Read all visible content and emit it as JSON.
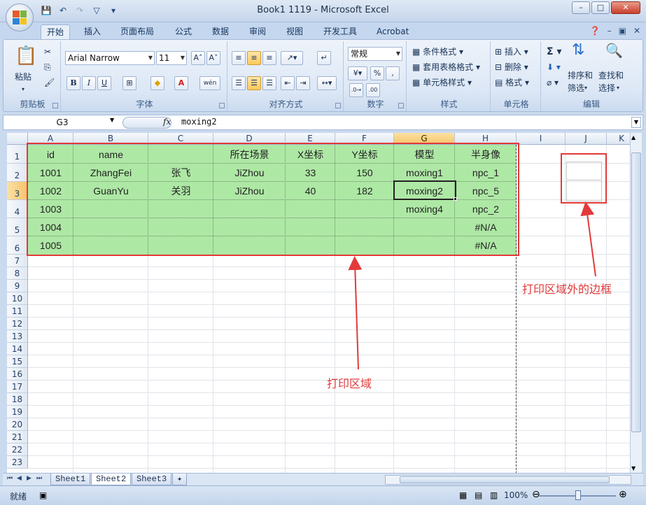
{
  "window": {
    "title": "Book1 1119 - Microsoft Excel"
  },
  "tabs": [
    "开始",
    "插入",
    "页面布局",
    "公式",
    "数据",
    "审阅",
    "视图",
    "开发工具",
    "Acrobat"
  ],
  "ribbon": {
    "groups": {
      "clipboard": "剪贴板",
      "font": "字体",
      "alignment": "对齐方式",
      "number": "数字",
      "styles": "样式",
      "cells": "单元格",
      "editing": "编辑"
    },
    "paste_label": "粘贴",
    "font_name": "Arial Narrow",
    "font_size": "11",
    "number_format": "常规",
    "styles_items": [
      "条件格式",
      "套用表格格式",
      "单元格样式"
    ],
    "cells_items": [
      "插入",
      "删除",
      "格式"
    ],
    "sort_label_1": "排序和",
    "sort_label_2": "筛选",
    "find_label_1": "查找和",
    "find_label_2": "选择",
    "percent": "%"
  },
  "formula_bar": {
    "name_box": "G3",
    "fx": "fx",
    "content": "moxing2"
  },
  "columns": [
    "A",
    "B",
    "C",
    "D",
    "E",
    "F",
    "G",
    "H",
    "I",
    "J",
    "K"
  ],
  "rows": [
    "1",
    "2",
    "3",
    "4",
    "5",
    "6",
    "7",
    "8",
    "9",
    "10",
    "11",
    "12",
    "13",
    "14",
    "15",
    "16",
    "17",
    "18",
    "19",
    "20",
    "21",
    "22",
    "23"
  ],
  "table": {
    "header": [
      "id",
      "name",
      "",
      "所在场景",
      "X坐标",
      "Y坐标",
      "模型",
      "半身像"
    ],
    "rows": [
      [
        "1001",
        "ZhangFei",
        "张飞",
        "JiZhou",
        "33",
        "150",
        "moxing1",
        "npc_1"
      ],
      [
        "1002",
        "GuanYu",
        "关羽",
        "JiZhou",
        "40",
        "182",
        "moxing2",
        "npc_5"
      ],
      [
        "1003",
        "",
        "",
        "",
        "",
        "",
        "moxing4",
        "npc_2"
      ],
      [
        "1004",
        "",
        "",
        "",
        "",
        "",
        "",
        "#N/A"
      ],
      [
        "1005",
        "",
        "",
        "",
        "",
        "",
        "",
        "#N/A"
      ]
    ]
  },
  "annotations": {
    "print_area": "打印区域",
    "outside_border": "打印区域外的边框"
  },
  "sheet_tabs": [
    "Sheet1",
    "Sheet2",
    "Sheet3"
  ],
  "active_sheet": "Sheet2",
  "status": {
    "mode": "就绪",
    "zoom": "100%"
  },
  "colors": {
    "fill": "#aee8a5",
    "annotation": "#e23a3a"
  }
}
